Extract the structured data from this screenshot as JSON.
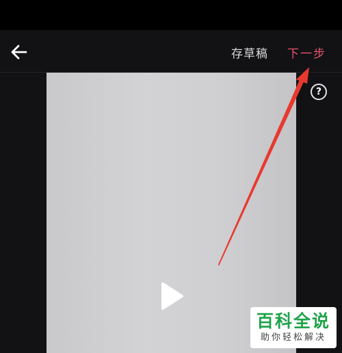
{
  "toolbar": {
    "back_icon": "arrow-left-icon",
    "save_draft_label": "存草稿",
    "next_step_label": "下一步"
  },
  "stage": {
    "help_icon": "question-circle-icon",
    "help_label": "?",
    "play_icon": "play-icon"
  },
  "watermark": {
    "title": "百科全说",
    "subtitle": "助你轻松解决"
  },
  "colors": {
    "accent": "#e8546e",
    "annotation_arrow": "#e8392f",
    "watermark_green": "#1fa34a"
  }
}
